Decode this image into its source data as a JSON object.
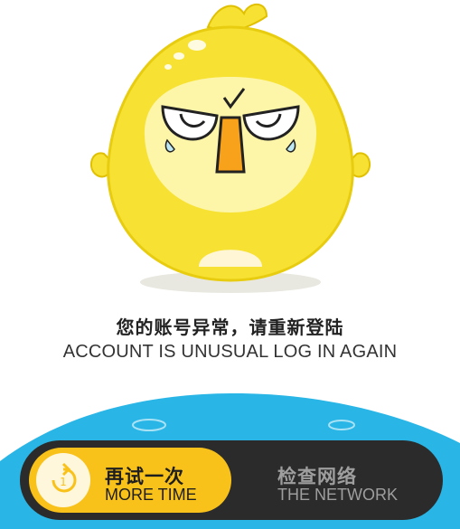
{
  "error": {
    "message_cn": "您的账号异常，请重新登陆",
    "message_en": "ACCOUNT IS UNUSUAL LOG IN AGAIN",
    "illustration_icon": "angry-yellow-chick-mascot"
  },
  "actions": {
    "retry": {
      "label_cn": "再试一次",
      "label_en": "MORE TIME",
      "icon": "retry-icon",
      "icon_text": "1",
      "color": "#f9c21a"
    },
    "check_network": {
      "label_cn": "检查网络",
      "label_en": "THE NETWORK"
    }
  },
  "colors": {
    "accent_blue": "#29b6e6",
    "bar": "#2b2b2b",
    "mascot_yellow": "#f7e233"
  }
}
